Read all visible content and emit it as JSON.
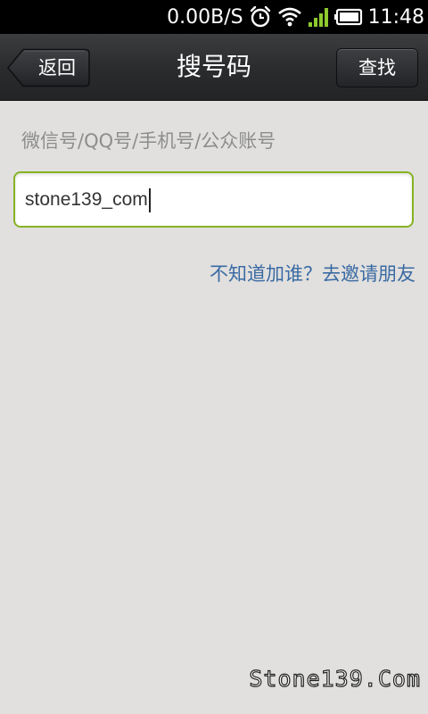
{
  "status_bar": {
    "net_speed": "0.00B/S",
    "time": "11:48",
    "icons": [
      "alarm-icon",
      "wifi-icon",
      "signal-icon",
      "battery-icon"
    ],
    "signal_color": "#8ec92e"
  },
  "title_bar": {
    "back_label": "返回",
    "title": "搜号码",
    "search_label": "查找"
  },
  "form": {
    "hint": "微信号/QQ号/手机号/公众账号",
    "input_value": "stone139_com",
    "focus_color": "#86b324"
  },
  "invite_link": "不知道加谁？去邀请朋友",
  "watermark": "Stone139.Com"
}
